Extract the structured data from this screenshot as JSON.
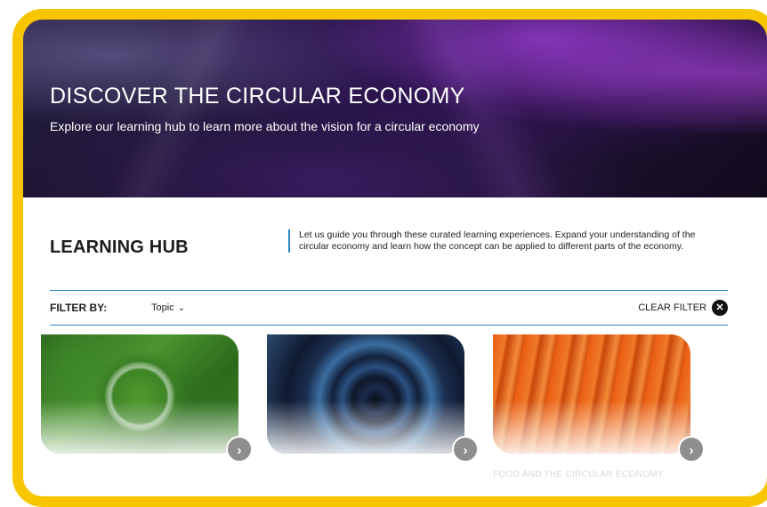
{
  "hero": {
    "title": "DISCOVER THE CIRCULAR ECONOMY",
    "subtitle": "Explore our learning hub to learn more about the vision for a circular economy"
  },
  "hub": {
    "title": "LEARNING HUB",
    "description": "Let us guide you through these curated learning experiences. Expand your understanding of the circular economy and learn how the concept can be applied to different parts of the economy."
  },
  "filter": {
    "label": "FILTER BY:",
    "topic": "Topic",
    "clear": "CLEAR FILTER"
  },
  "cards": [
    {
      "caption": "",
      "image": "forest-magnifier"
    },
    {
      "caption": "",
      "image": "tunnel-spiral"
    },
    {
      "caption": "FOOD AND THE CIRCULAR ECONOMY",
      "image": "carrots"
    }
  ],
  "colors": {
    "frame": "#F7C600",
    "accent": "#2b86c5"
  }
}
